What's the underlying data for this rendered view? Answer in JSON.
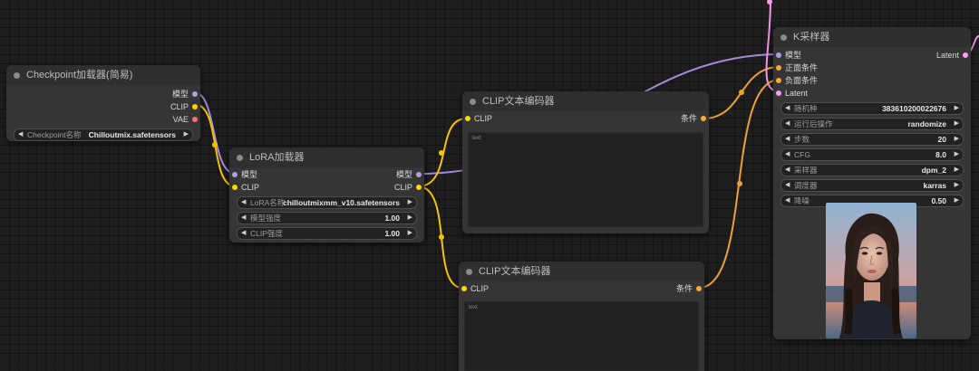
{
  "colors": {
    "model": "#b39ddb",
    "clip": "#ffd500",
    "vae": "#ff6e6e",
    "conditioning": "#ffa931",
    "latent": "#ff9cf9",
    "wire_model": "#a58bd8",
    "wire_clip": "#f5c400",
    "wire_cond": "#f0a030",
    "wire_latent": "#f49ae8"
  },
  "checkpoint_node": {
    "title": "Checkpoint加载器(简易)",
    "outputs": [
      "模型",
      "CLIP",
      "VAE"
    ],
    "widget": {
      "label": "Checkpoint名称",
      "value": "Chilloutmix.safetensors"
    }
  },
  "lora_node": {
    "title": "LoRA加载器",
    "inputs": [
      "模型",
      "CLIP"
    ],
    "outputs": [
      "模型",
      "CLIP"
    ],
    "widgets": [
      {
        "label": "LoRA名称",
        "value": "chilloutmixmm_v10.safetensors"
      },
      {
        "label": "模型强度",
        "value": "1.00"
      },
      {
        "label": "CLIP强度",
        "value": "1.00"
      }
    ]
  },
  "clip_encoder_1": {
    "title": "CLIP文本编码器",
    "input": "CLIP",
    "output": "条件",
    "text_placeholder": "text"
  },
  "clip_encoder_2": {
    "title": "CLIP文本编码器",
    "input": "CLIP",
    "output": "条件",
    "text_placeholder": "text"
  },
  "ksampler_node": {
    "title": "K采样器",
    "inputs": [
      "模型",
      "正面条件",
      "负面条件",
      "Latent"
    ],
    "output": "Latent",
    "widgets": [
      {
        "label": "随机种",
        "value": "383610200022676"
      },
      {
        "label": "运行后操作",
        "value": "randomize"
      },
      {
        "label": "步数",
        "value": "20"
      },
      {
        "label": "CFG",
        "value": "8.0"
      },
      {
        "label": "采样器",
        "value": "dpm_2"
      },
      {
        "label": "调度器",
        "value": "karras"
      },
      {
        "label": "降噪",
        "value": "0.50"
      }
    ]
  },
  "arrows": {
    "left": "◀",
    "right": "▶"
  }
}
